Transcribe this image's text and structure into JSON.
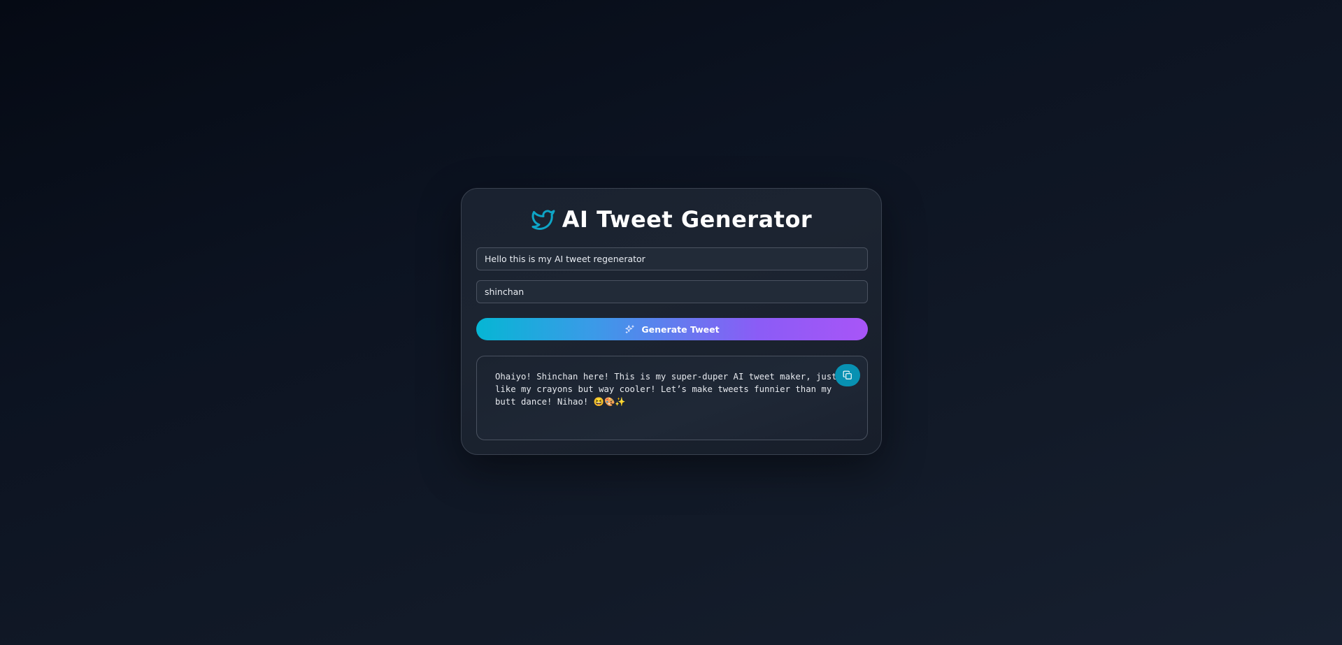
{
  "app": {
    "title": "AI Tweet Generator",
    "icon": "twitter-bird-icon",
    "accent_color": "#1da1f2"
  },
  "form": {
    "topic_input": {
      "value": "Hello this is my AI tweet regenerator"
    },
    "persona_input": {
      "value": "shinchan"
    },
    "generate_button": {
      "label": "Generate Tweet",
      "icon": "sparkles-icon",
      "gradient_start": "#06b6d4",
      "gradient_end": "#a855f7"
    }
  },
  "output": {
    "text": "Ohaiyo! Shinchan here! This is my super-duper AI tweet maker, just like my crayons but way cooler! Let’s make tweets funnier than my butt dance! Nihao! 😆🎨✨",
    "copy_button": {
      "icon": "copy-icon",
      "color": "#0891b2"
    }
  }
}
